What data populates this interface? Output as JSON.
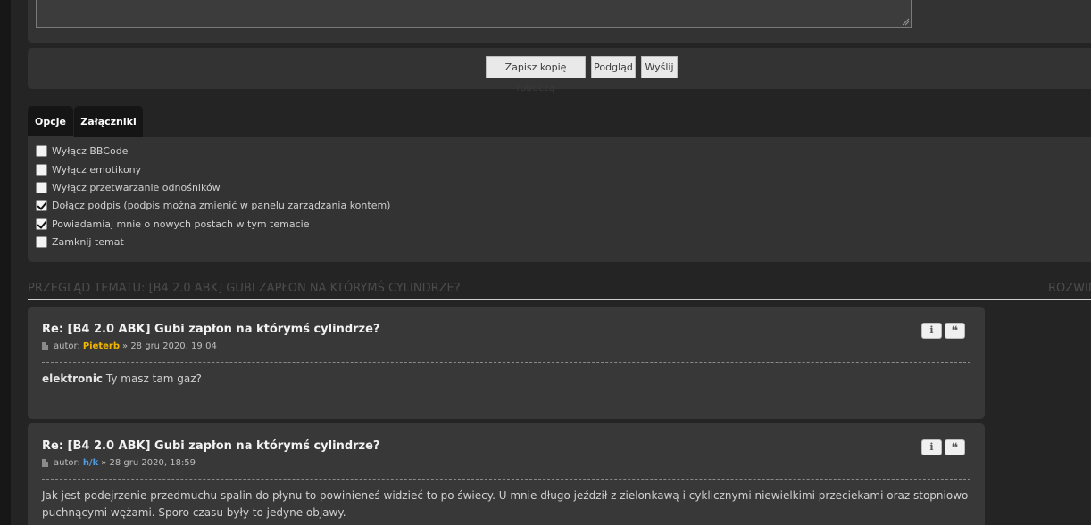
{
  "posting": {
    "buttons": {
      "save_draft": "Zapisz kopię roboczą",
      "preview": "Podgląd",
      "submit": "Wyślij"
    },
    "tabs": [
      {
        "label": "Opcje",
        "active": true
      },
      {
        "label": "Załączniki",
        "active": false
      }
    ],
    "options": [
      {
        "label": "Wyłącz BBCode",
        "checked": false
      },
      {
        "label": "Wyłącz emotikony",
        "checked": false
      },
      {
        "label": "Wyłącz przetwarzanie odnośników",
        "checked": false
      },
      {
        "label": "Dołącz podpis (podpis można zmienić w panelu zarządzania kontem)",
        "checked": true
      },
      {
        "label": "Powiadamiaj mnie o nowych postach w tym temacie",
        "checked": true
      },
      {
        "label": "Zamknij temat",
        "checked": false
      }
    ]
  },
  "topic_review": {
    "title": "Przegląd tematu: [B4 2.0 ABK] Gubi zapłon na którymś cylindrze?",
    "expand_label": "Rozwiń"
  },
  "posts": [
    {
      "title": "Re: [B4 2.0 ABK] Gubi zapłon na którymś cylindrze?",
      "author_prefix": "autor:",
      "author": "Pieterb",
      "author_color": "#f2b600",
      "date": "» 28 gru 2020, 19:04",
      "quote_name": "elektronic",
      "body": "Ty masz tam gaz?"
    },
    {
      "title": "Re: [B4 2.0 ABK] Gubi zapłon na którymś cylindrze?",
      "author_prefix": "autor:",
      "author": "h/k",
      "author_color": "#4d9ee6",
      "date": "» 28 gru 2020, 18:59",
      "body": "Jak jest podejrzenie przedmuchu spalin do płynu to powinieneś widzieć to po świecy. U mnie długo jeździł z zielonkawą i cyklicznymi niewielkimi przeciekami oraz stopniowo puchnącymi wężami. Sporo czasu były to jedyne objawy."
    }
  ],
  "icons": {
    "info": "info-icon",
    "quote": "quote-icon"
  }
}
